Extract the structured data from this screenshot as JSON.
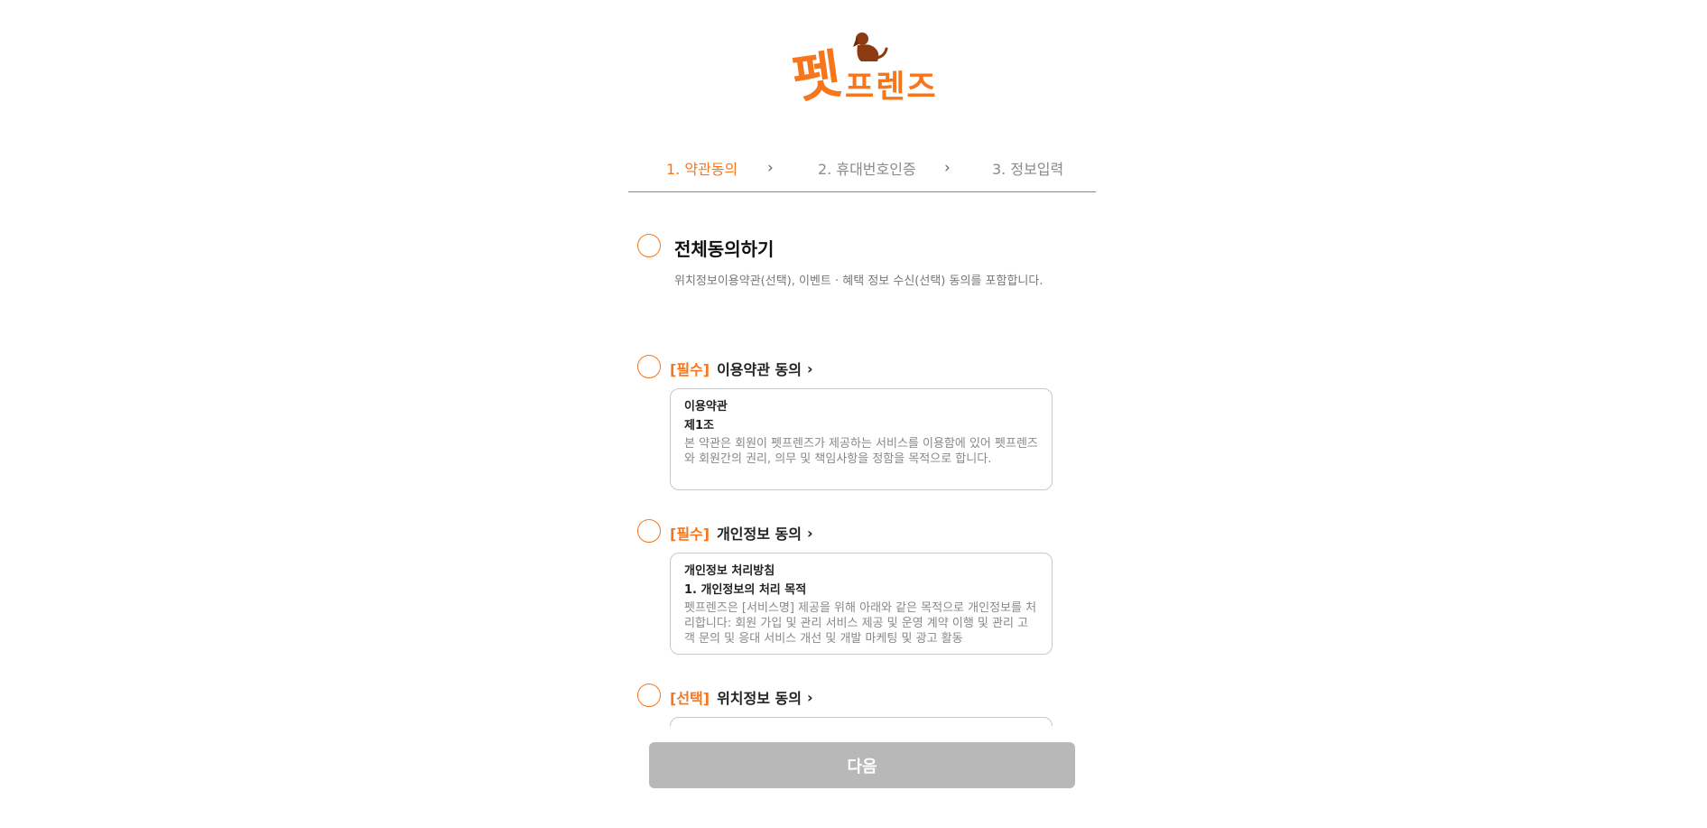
{
  "logo": {
    "main": "펫",
    "sub": "프렌즈"
  },
  "steps": [
    {
      "label": "1. 약관동의",
      "active": true
    },
    {
      "label": "2. 휴대번호인증",
      "active": false
    },
    {
      "label": "3. 정보입력",
      "active": false
    }
  ],
  "step_separator": "›",
  "agree_all": {
    "title": "전체동의하기",
    "description": "위치정보이용약관(선택), 이벤트 · 혜택 정보 수신(선택) 동의를 포함합니다."
  },
  "terms": [
    {
      "tag": "[필수]",
      "label": "이용약관 동의",
      "box_title": "이용약관",
      "box_subtitle": "제1조",
      "box_body": "본 약관은 회원이 펫프렌즈가 제공하는 서비스를 이용함에 있어 펫프렌즈와 회원간의 권리, 의무 및 책임사항을 정함을 목적으로 합니다."
    },
    {
      "tag": "[필수]",
      "label": "개인정보 동의",
      "box_title": "개인정보 처리방침",
      "box_subtitle": "1. 개인정보의 처리 목적",
      "box_body": "펫프렌즈은 [서비스명] 제공을 위해 아래와 같은 목적으로 개인정보를 처리합니다: 회원 가입 및 관리 서비스 제공 및 운영 계약 이행 및 관리 고객 문의 및 응대 서비스 개선 및 개발 마케팅 및 광고 활동"
    },
    {
      "tag": "[선택]",
      "label": "위치정보 동의"
    }
  ],
  "next_button": {
    "label": "다음"
  },
  "colors": {
    "accent": "#f7761c",
    "disabled_button": "#b8b8b8",
    "muted_text": "#888888"
  },
  "icons": {
    "step_chevron": "chevron-right-icon",
    "row_chevron": "chevron-right-icon",
    "checkbox": "circle-check-icon"
  }
}
